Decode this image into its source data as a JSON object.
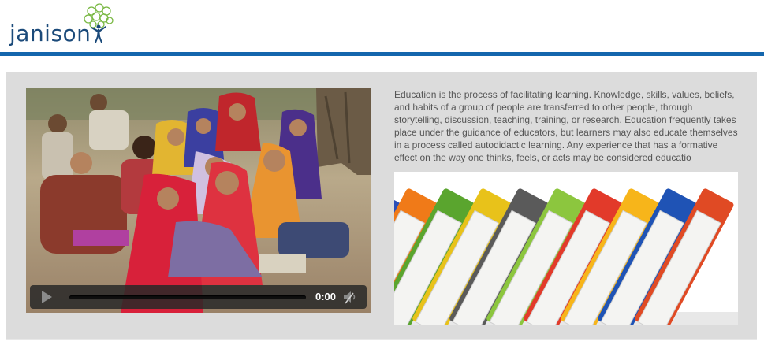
{
  "header": {
    "logo_text": "janison",
    "accent_color": "#1466ad",
    "logo_color": "#1b4a7a"
  },
  "video": {
    "icon_play": "play-icon",
    "icon_mute": "mute-icon",
    "time": "0:00",
    "progress": 0
  },
  "article": {
    "text": "Education is the process of facilitating learning. Knowledge, skills, values, beliefs, and habits of a group of people are transferred to other people, through storytelling, discussion, teaching, training, or research. Education frequently takes place under the guidance of educators, but learners may also educate themselves in a process called autodidactic learning. Any experience that has a formative effect on the way one thinks, feels, or acts may be considered educatio"
  },
  "colors": {
    "panel_bg": "#dcdcdc",
    "body_text": "#555555"
  }
}
